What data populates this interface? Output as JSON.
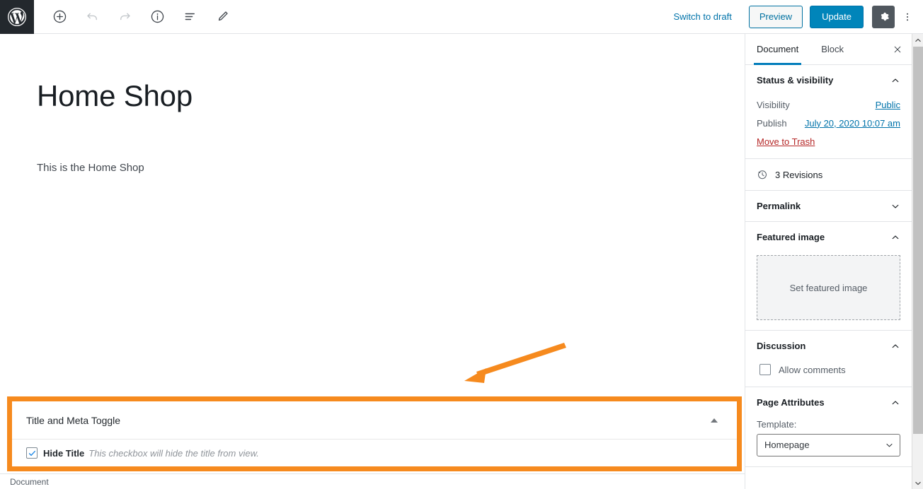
{
  "toolbar": {
    "logo_icon": "wordpress-logo",
    "left_tools": [
      {
        "name": "add-block-button",
        "icon": "plus-circle-icon",
        "disabled": false
      },
      {
        "name": "undo-button",
        "icon": "undo-icon",
        "disabled": true
      },
      {
        "name": "redo-button",
        "icon": "redo-icon",
        "disabled": true
      },
      {
        "name": "content-info-button",
        "icon": "info-circle-icon",
        "disabled": false
      },
      {
        "name": "block-navigation-button",
        "icon": "list-view-icon",
        "disabled": false
      },
      {
        "name": "edit-mode-button",
        "icon": "pencil-icon",
        "disabled": false
      }
    ],
    "switch_to_draft_label": "Switch to draft",
    "preview_label": "Preview",
    "update_label": "Update",
    "settings_icon": "gear-icon",
    "more_menu_icon": "kebab-menu-icon"
  },
  "editor": {
    "post_title": "Home Shop",
    "paragraph": "This is the Home Shop"
  },
  "annotation": {
    "arrow_color": "#f68a1e",
    "highlight_color": "#f68a1e"
  },
  "metabox": {
    "title": "Title and Meta Toggle",
    "toggle_icon": "triangle-up-icon",
    "checkbox_checked": true,
    "checkbox_label": "Hide Title",
    "checkbox_description": "This checkbox will hide the title from view."
  },
  "breadcrumb": {
    "text": "Document"
  },
  "sidebar": {
    "tabs": [
      {
        "label": "Document",
        "active": true
      },
      {
        "label": "Block",
        "active": false
      }
    ],
    "close_icon": "close-icon",
    "status_panel": {
      "title": "Status & visibility",
      "expanded": true,
      "visibility_label": "Visibility",
      "visibility_value": "Public",
      "publish_label": "Publish",
      "publish_value": "July 20, 2020 10:07 am",
      "trash_label": "Move to Trash"
    },
    "revisions": {
      "icon": "history-clock-icon",
      "label": "3 Revisions"
    },
    "permalink_panel": {
      "title": "Permalink",
      "expanded": false
    },
    "featured_image_panel": {
      "title": "Featured image",
      "expanded": true,
      "dropzone_label": "Set featured image"
    },
    "discussion_panel": {
      "title": "Discussion",
      "expanded": true,
      "allow_comments_label": "Allow comments",
      "allow_comments_checked": false
    },
    "page_attributes_panel": {
      "title": "Page Attributes",
      "expanded": true,
      "template_label": "Template:",
      "template_value": "Homepage",
      "template_options": [
        "Homepage"
      ]
    }
  },
  "scrollbar": {
    "up_icon": "chevron-up-icon",
    "down_icon": "chevron-down-icon"
  }
}
